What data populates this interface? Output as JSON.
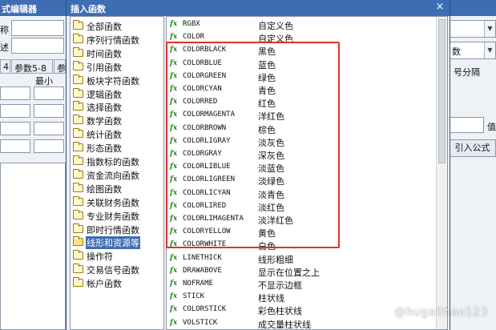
{
  "background": {
    "title": "式编辑器",
    "label_name": "称",
    "label_desc": "述",
    "tab_4": "4",
    "tab_params": "参数5-8",
    "tab_cut": "参",
    "col_min": "最小",
    "right_field_1": "数",
    "right_field_2": "号分隔",
    "right_btn_value": "值",
    "right_btn_import": "引入公式"
  },
  "dialog": {
    "title": "插入函数",
    "close_glyph": "×",
    "categories": [
      {
        "label": "全部函数"
      },
      {
        "label": "序列行情函数"
      },
      {
        "label": "时间函数"
      },
      {
        "label": "引用函数"
      },
      {
        "label": "板块字符函数"
      },
      {
        "label": "逻辑函数"
      },
      {
        "label": "选择函数"
      },
      {
        "label": "数学函数"
      },
      {
        "label": "统计函数"
      },
      {
        "label": "形态函数"
      },
      {
        "label": "指数标的函数"
      },
      {
        "label": "资金流向函数"
      },
      {
        "label": "绘图函数"
      },
      {
        "label": "关联财务函数"
      },
      {
        "label": "专业财务函数"
      },
      {
        "label": "即时行情函数"
      },
      {
        "label": "线形和资源等"
      },
      {
        "label": "操作符"
      },
      {
        "label": "交易信号函数"
      },
      {
        "label": "帐户函数"
      }
    ],
    "selected_category_index": 16,
    "fx_label": "fx",
    "functions": [
      {
        "name": "RGBX",
        "desc": "自定义色"
      },
      {
        "name": "COLOR",
        "desc": "自定义色"
      },
      {
        "name": "COLORBLACK",
        "desc": "黑色"
      },
      {
        "name": "COLORBLUE",
        "desc": "蓝色"
      },
      {
        "name": "COLORGREEN",
        "desc": "绿色"
      },
      {
        "name": "COLORCYAN",
        "desc": "青色"
      },
      {
        "name": "COLORRED",
        "desc": "红色"
      },
      {
        "name": "COLORMAGENTA",
        "desc": "洋红色"
      },
      {
        "name": "COLORBROWN",
        "desc": "棕色"
      },
      {
        "name": "COLORLIGRAY",
        "desc": "淡灰色"
      },
      {
        "name": "COLORGRAY",
        "desc": "深灰色"
      },
      {
        "name": "COLORLIBLUE",
        "desc": "淡蓝色"
      },
      {
        "name": "COLORLIGREEN",
        "desc": "淡绿色"
      },
      {
        "name": "COLORLICYAN",
        "desc": "淡青色"
      },
      {
        "name": "COLORLIRED",
        "desc": "淡红色"
      },
      {
        "name": "COLORLIMAGENTA",
        "desc": "淡洋红色"
      },
      {
        "name": "COLORYELLOW",
        "desc": "黄色"
      },
      {
        "name": "COLORWHITE",
        "desc": "白色"
      },
      {
        "name": "LINETHICK",
        "desc": "线形粗细"
      },
      {
        "name": "DRAWABOVE",
        "desc": "显示在位置之上"
      },
      {
        "name": "NOFRAME",
        "desc": "不显示边框"
      },
      {
        "name": "STICK",
        "desc": "柱状线"
      },
      {
        "name": "COLORSTICK",
        "desc": "彩色柱状线"
      },
      {
        "name": "VOLSTICK",
        "desc": "成交量柱状线"
      }
    ]
  },
  "watermark": "@huga0hao123",
  "colors": {
    "title_bar": "#3d6db3",
    "highlight_border": "#e0302d",
    "fx_green": "#1f8a1f"
  }
}
